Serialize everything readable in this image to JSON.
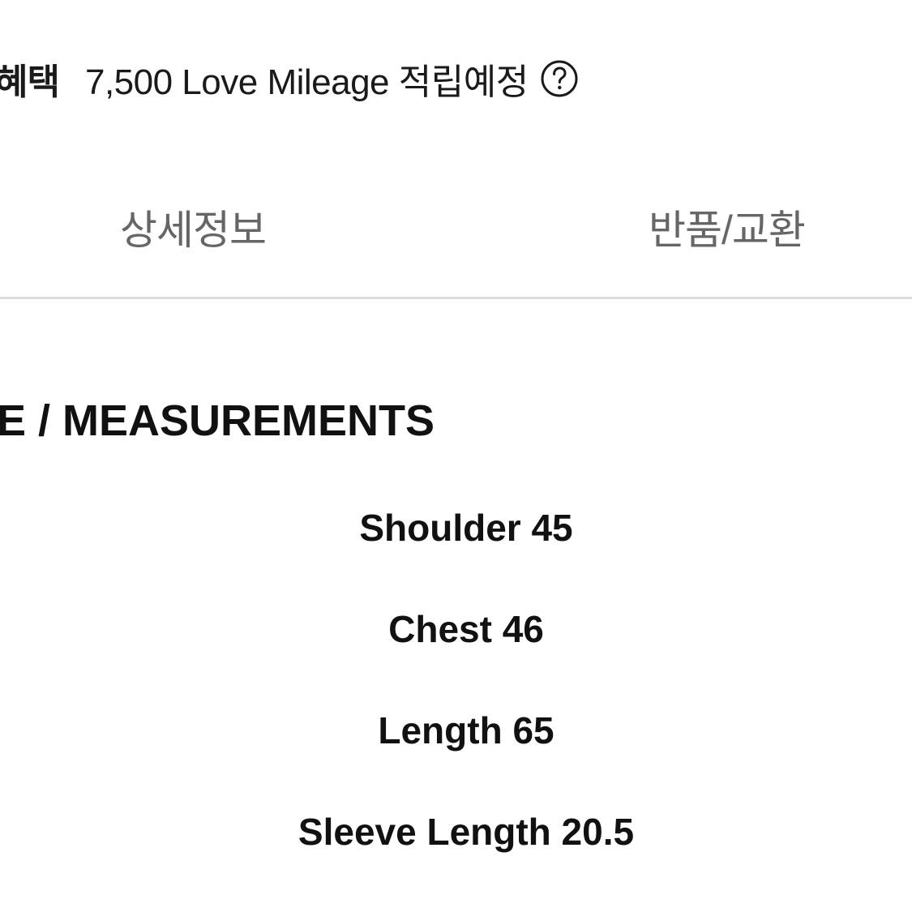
{
  "benefit": {
    "label": "혜택",
    "value": "7,500 Love Mileage 적립예정",
    "help_icon": "question-circle-icon"
  },
  "tabs": [
    {
      "label": "상세정보"
    },
    {
      "label": "반품/교환"
    }
  ],
  "section": {
    "heading": "E / MEASUREMENTS"
  },
  "measurements": [
    {
      "text": "Shoulder 45"
    },
    {
      "text": "Chest 46"
    },
    {
      "text": "Length 65"
    },
    {
      "text": "Sleeve Length 20.5"
    }
  ],
  "colors": {
    "text": "#111111",
    "tab_text": "#666666",
    "divider": "#dcdcdc",
    "background": "#ffffff"
  }
}
